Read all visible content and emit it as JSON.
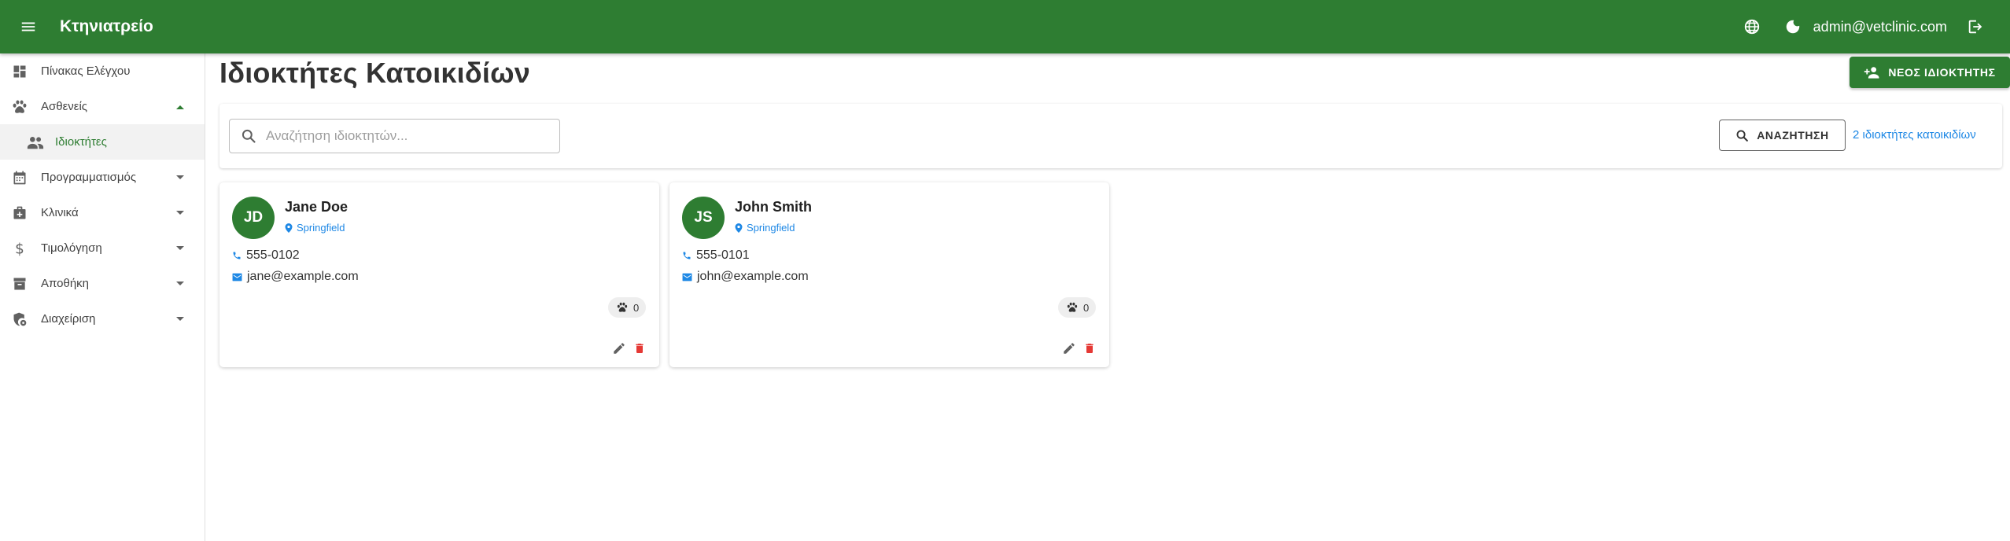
{
  "appbar": {
    "title": "Κτηνιατρείο",
    "user_email": "admin@vetclinic.com",
    "icons": [
      "menu-icon",
      "globe-icon",
      "dark-mode-icon",
      "logout-icon"
    ]
  },
  "sidebar": {
    "items": [
      {
        "label": "Πίνακας Ελέγχου",
        "icon": "dashboard-icon"
      },
      {
        "label": "Ασθενείς",
        "icon": "paw-icon",
        "expanded": true
      },
      {
        "label": "Ιδιοκτήτες",
        "icon": "people-icon",
        "active": true
      },
      {
        "label": "Προγραμματισμός",
        "icon": "calendar-icon"
      },
      {
        "label": "Κλινικά",
        "icon": "medical-bag-icon"
      },
      {
        "label": "Τιμολόγηση",
        "icon": "dollar-icon"
      },
      {
        "label": "Αποθήκη",
        "icon": "archive-icon"
      },
      {
        "label": "Διαχείριση",
        "icon": "admin-shield-icon"
      }
    ]
  },
  "main": {
    "title": "Ιδιοκτήτες Κατοικιδίων",
    "new_owner_label": "ΝΕΟΣ ΙΔΙΟΚΤΗΤΗΣ",
    "search": {
      "placeholder": "Αναζήτηση ιδιοκτητών...",
      "value": "",
      "button_label": "ΑΝΑΖΗΤΗΣΗ"
    },
    "owners_count": "2 ιδιοκτήτες κατοικιδίων",
    "owners": [
      {
        "initials": "JD",
        "name": "Jane Doe",
        "city": "Springfield",
        "phone": "555-0102",
        "email": "jane@example.com",
        "pets": "0"
      },
      {
        "initials": "JS",
        "name": "John Smith",
        "city": "Springfield",
        "phone": "555-0101",
        "email": "john@example.com",
        "pets": "0"
      }
    ]
  },
  "colors": {
    "primary": "#2e7d32",
    "link": "#1e88e5",
    "danger": "#e53935"
  }
}
